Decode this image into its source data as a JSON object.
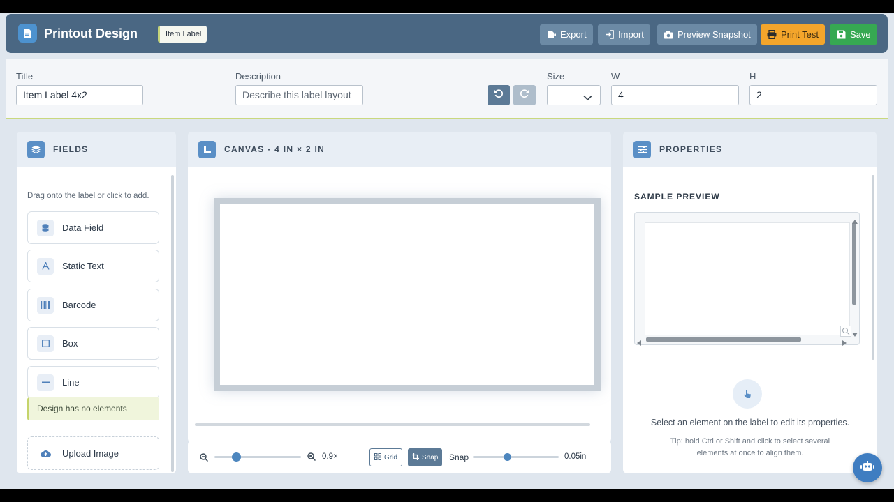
{
  "header": {
    "title": "Printout Design",
    "badge": "Item Label",
    "buttons": {
      "export": "Export",
      "import": "Import",
      "preview": "Preview Snapshot",
      "print": "Print Test",
      "save": "Save"
    }
  },
  "meta": {
    "title_label": "Title",
    "title_value": "Item Label 4x2",
    "description_label": "Description",
    "description_placeholder": "Describe this label layout",
    "size_label": "Size",
    "size_value": "",
    "w_label": "W",
    "w_value": "4",
    "h_label": "H",
    "h_value": "2"
  },
  "fields_panel": {
    "title": "FIELDS",
    "hint": "Drag onto the label or click to add.",
    "items": [
      {
        "label": "Data Field",
        "icon": "database-icon"
      },
      {
        "label": "Static Text",
        "icon": "text-icon"
      },
      {
        "label": "Barcode",
        "icon": "barcode-icon"
      },
      {
        "label": "Box",
        "icon": "square-icon"
      },
      {
        "label": "Line",
        "icon": "line-icon"
      }
    ],
    "empty_note": "Design has no elements",
    "upload_label": "Upload Image"
  },
  "canvas_panel": {
    "title": "CANVAS - 4 IN × 2 IN"
  },
  "zoom": {
    "zoom_value": "0.9×",
    "zoom_level": 0.25,
    "grid_label": "Grid",
    "snap_button_label": "Snap",
    "snap_label": "Snap",
    "snap_value": "0.05in",
    "snap_level": 0.4
  },
  "properties_panel": {
    "title": "PROPERTIES",
    "section": "SAMPLE PREVIEW",
    "empty_text": "Select an element on the label to edit its properties.",
    "tip": "Tip: hold Ctrl or Shift and click to select several elements at once to align them."
  },
  "colors": {
    "header_bg": "#4a6783",
    "accent_blue": "#4d92cf",
    "print_orange": "#f4a52b",
    "save_green": "#36a852",
    "lime_accent": "#c9d87f"
  }
}
